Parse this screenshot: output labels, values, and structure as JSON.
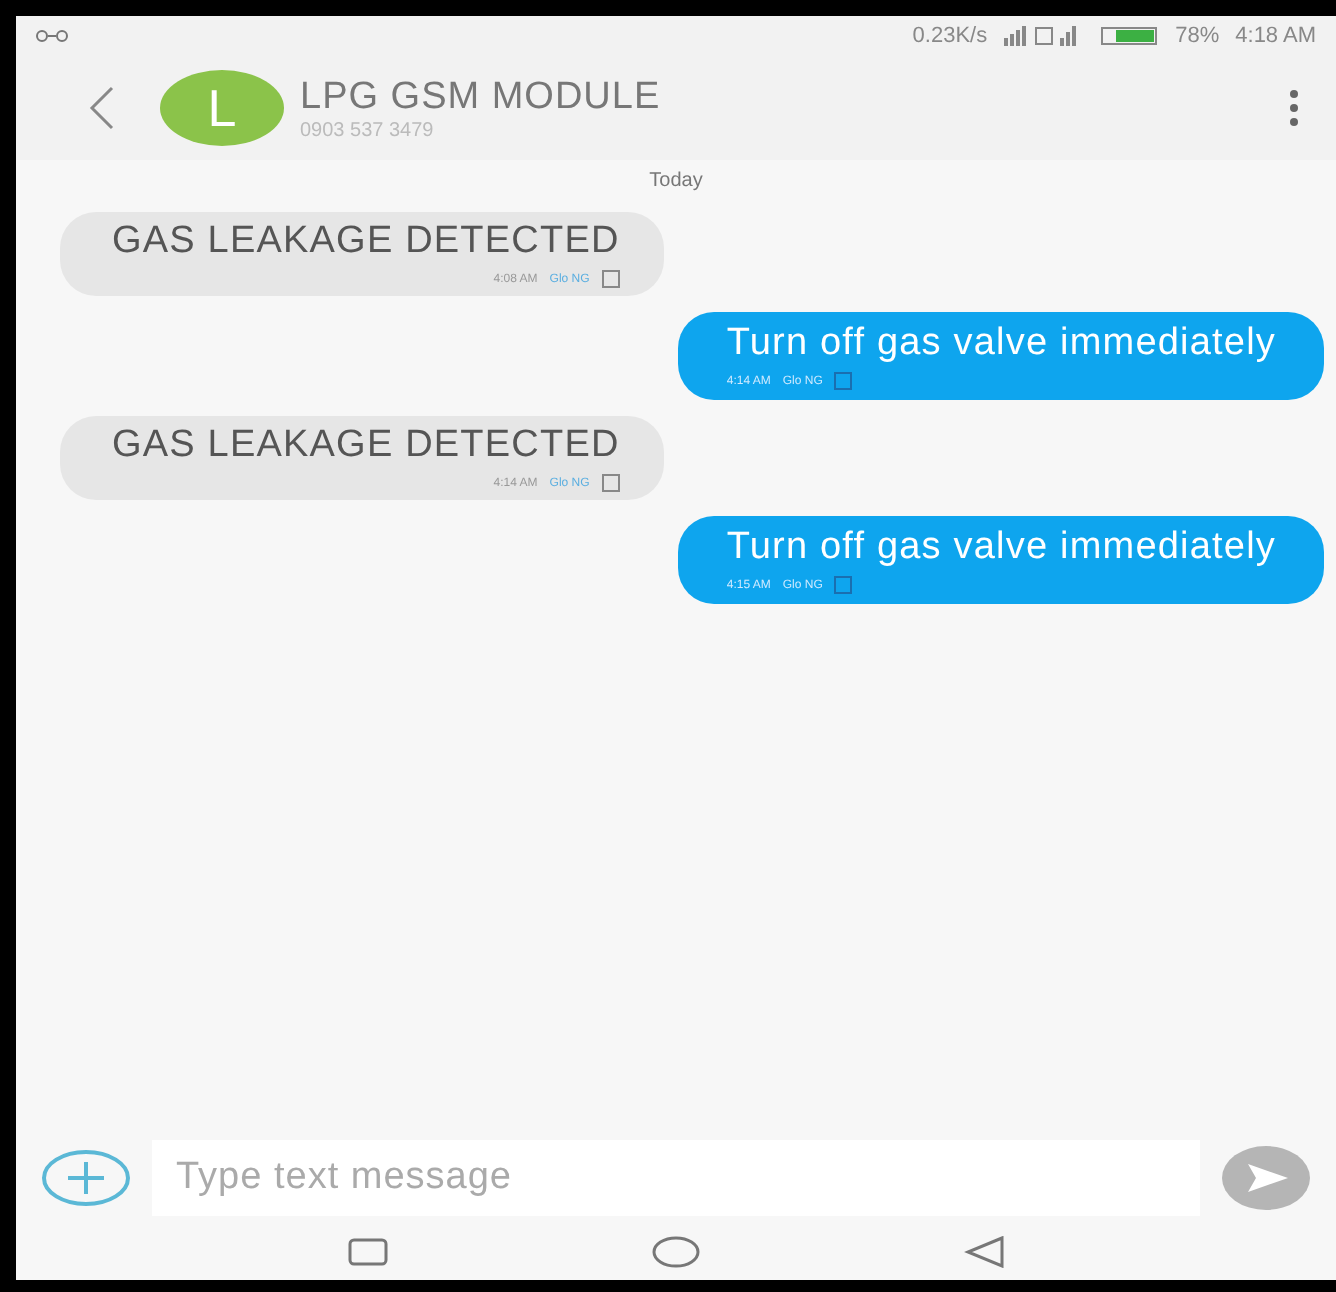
{
  "status_bar": {
    "speed": "0.23K/s",
    "battery": "78%",
    "time": "4:18 AM"
  },
  "header": {
    "avatar_letter": "L",
    "name": "LPG GSM MODULE",
    "number": "0903 537 3479"
  },
  "date_divider": "Today",
  "messages": [
    {
      "kind": "incoming",
      "text": "GAS LEAKAGE DETECTED",
      "time": "4:08 AM",
      "sim": "Glo NG"
    },
    {
      "kind": "outgoing",
      "text": "Turn off gas valve immediately",
      "time": "4:14 AM",
      "sim": "Glo NG"
    },
    {
      "kind": "incoming",
      "text": "GAS LEAKAGE DETECTED",
      "time": "4:14 AM",
      "sim": "Glo NG"
    },
    {
      "kind": "outgoing",
      "text": "Turn off gas valve immediately",
      "time": "4:15 AM",
      "sim": "Glo NG"
    }
  ],
  "composer": {
    "placeholder": "Type text message"
  }
}
